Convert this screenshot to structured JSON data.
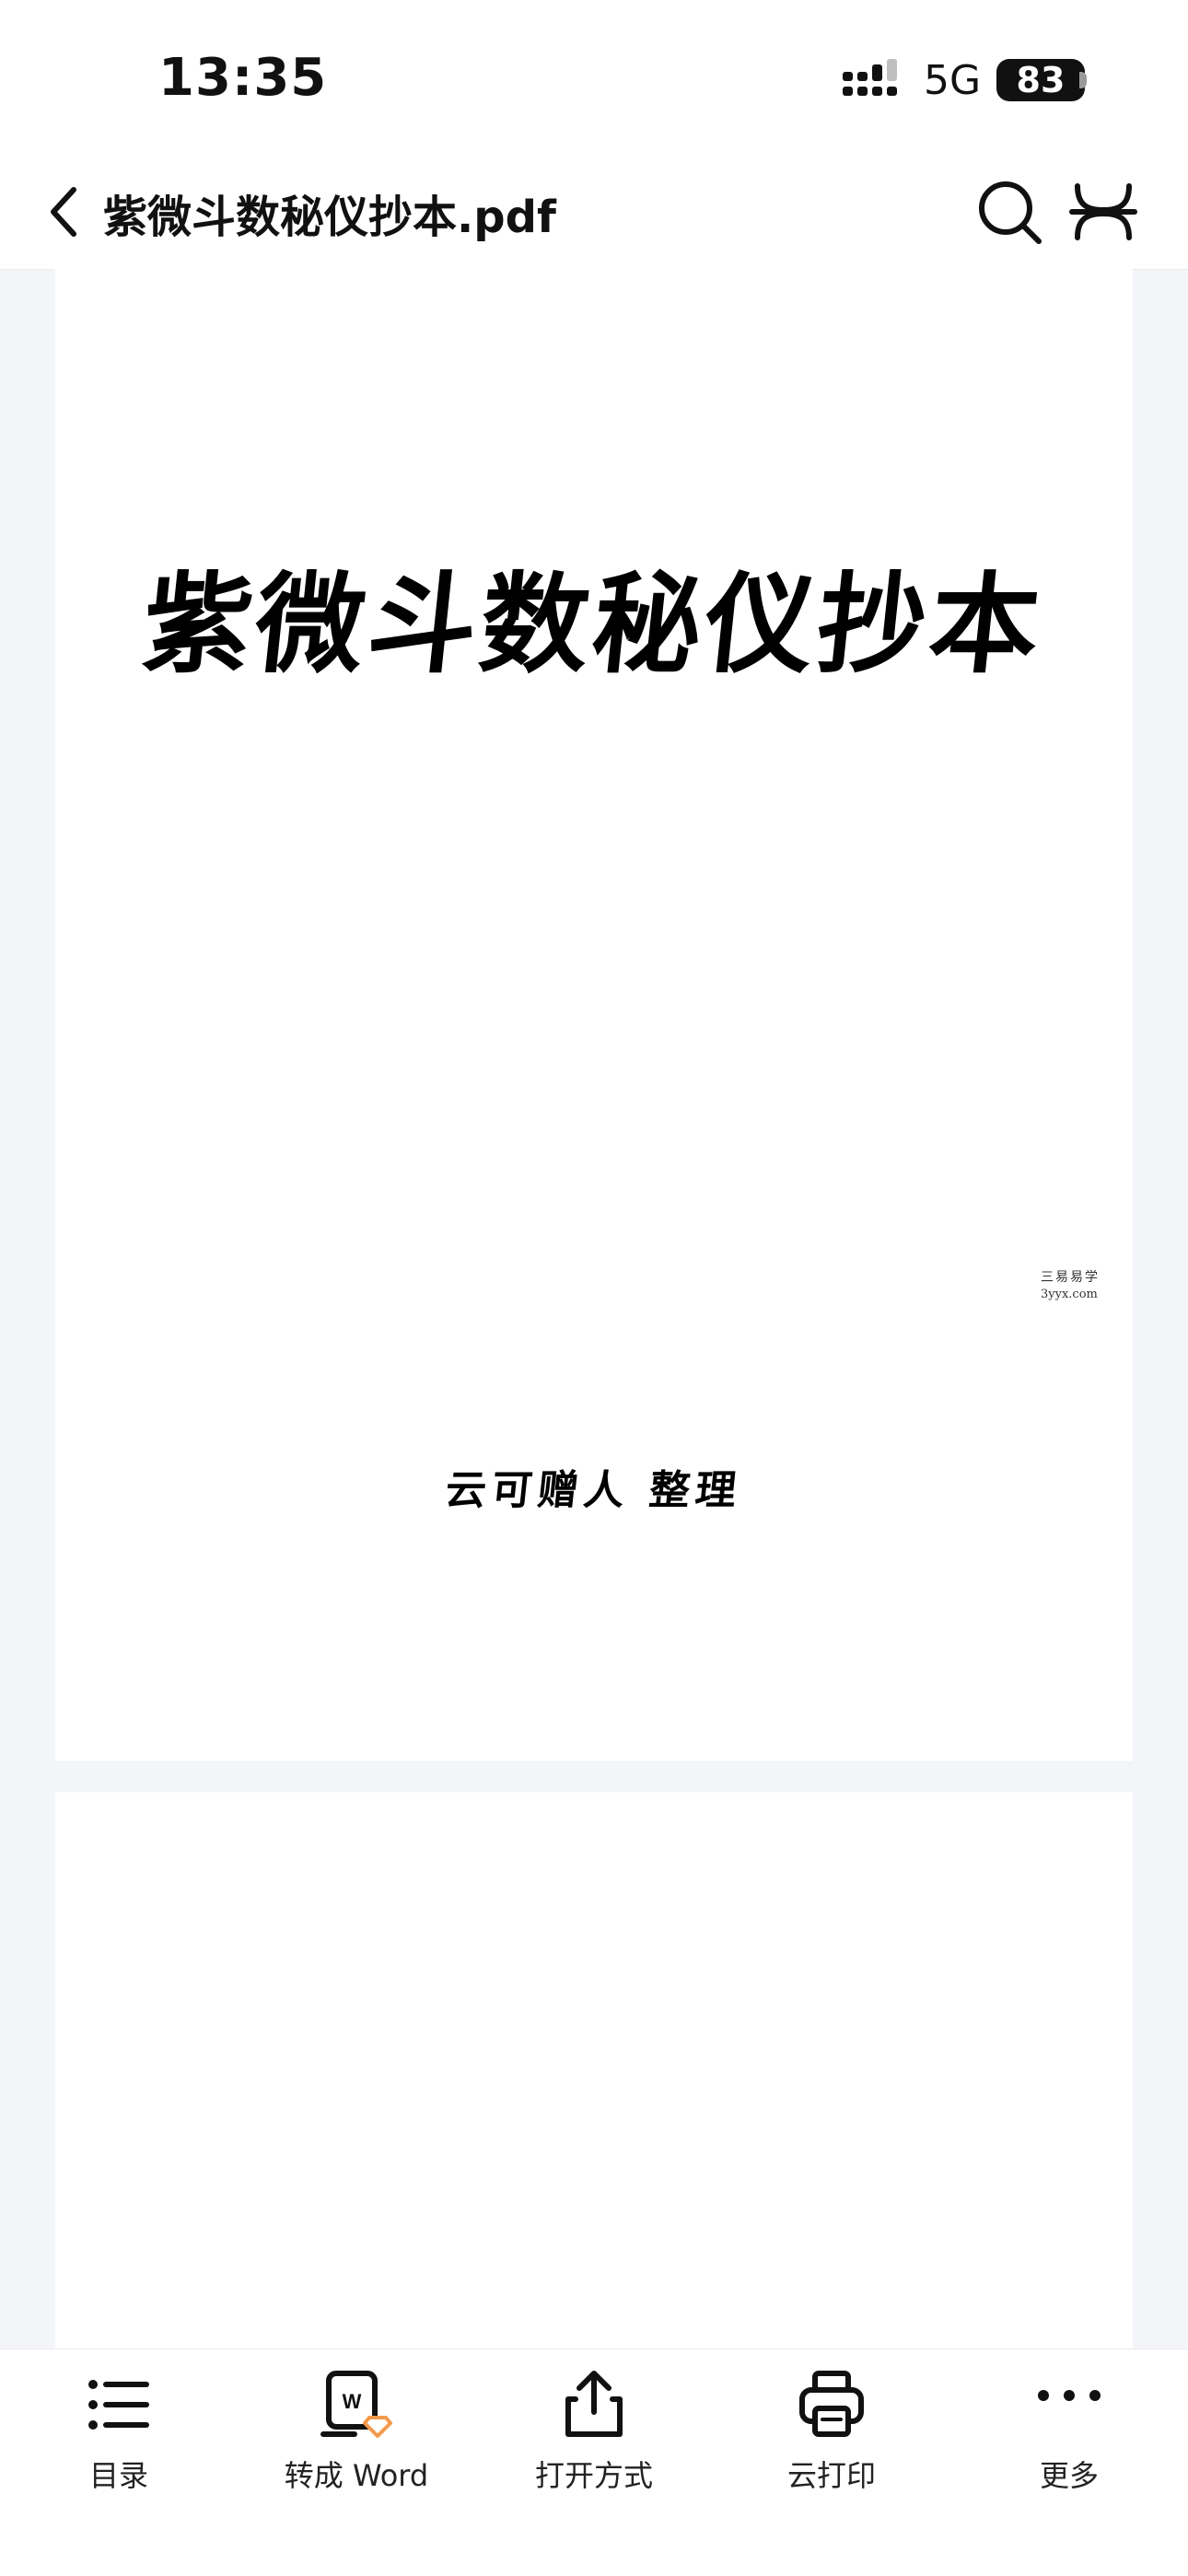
{
  "status_bar": {
    "time": "13:35",
    "network": "5G",
    "battery": "83",
    "icons": [
      "signal-icon",
      "battery-icon"
    ]
  },
  "nav": {
    "back_icon": "chevron-left-icon",
    "title": "紫微斗数秘仪抄本.pdf",
    "search_icon": "search-icon",
    "tools_icon": "tool-icon"
  },
  "document": {
    "page1": {
      "title": "紫微斗数秘仪抄本",
      "author": "云可赠人 整理",
      "watermark_name": "三易易学",
      "watermark_site": "3yyx.com"
    }
  },
  "toolbar": {
    "items": [
      {
        "label": "目录",
        "icon": "list-icon"
      },
      {
        "label": "转成 Word",
        "icon": "word-convert-icon"
      },
      {
        "label": "打开方式",
        "icon": "share-icon"
      },
      {
        "label": "云打印",
        "icon": "printer-icon"
      },
      {
        "label": "更多",
        "icon": "more-icon"
      }
    ]
  },
  "colors": {
    "accent_orange": "#f39a4a",
    "text": "#111111",
    "background": "#f4f5f9"
  }
}
